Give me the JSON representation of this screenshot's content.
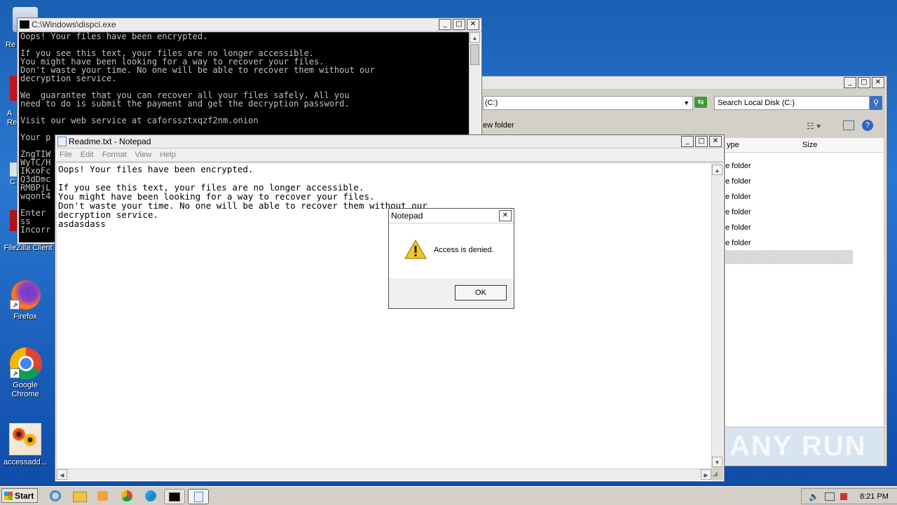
{
  "desktop": {
    "icons": [
      {
        "label": "Re",
        "icon": "recycle-bin-icon"
      },
      {
        "label": "A\nRe",
        "icon": "acrobat-reader-icon"
      },
      {
        "label": "C",
        "icon": "ccleaner-icon"
      },
      {
        "label": "FileZilla Client",
        "icon": "filezilla-icon"
      },
      {
        "label": "Firefox",
        "icon": "firefox-icon"
      },
      {
        "label": "Google\nChrome",
        "icon": "chrome-icon"
      },
      {
        "label": "accessadd...",
        "icon": "flowers-file-icon"
      }
    ]
  },
  "console_window": {
    "title": "C:\\Windows\\dispci.exe",
    "text": "Oops! Your files have been encrypted.\n\nIf you see this text, your files are no longer accessible.\nYou might have been looking for a way to recover your files.\nDon't waste your time. No one will be able to recover them without our\ndecryption service.\n\nWe  guarantee that you can recover all your files safely. All you\nneed to do is submit the payment and get the decryption password.\n\nVisit our web service at caforssztxqzf2nm.onion\n\nYour p\n\nZngTIW\nWyTC/H\nIKxoFc\nQ3dDmc\nRMBPjL\nwqont4\n\nEnter\nss\nIncorr"
  },
  "explorer_window": {
    "address": "(C:)",
    "search_placeholder": "Search Local Disk (C:)",
    "toolbar_new_folder": "ew folder",
    "columns": [
      "ype",
      "Size"
    ],
    "rows": [
      {
        "type": "e folder",
        "size": ""
      },
      {
        "type": "e folder",
        "size": ""
      },
      {
        "type": "e folder",
        "size": ""
      },
      {
        "type": "e folder",
        "size": ""
      },
      {
        "type": "e folder",
        "size": ""
      },
      {
        "type": "e folder",
        "size": ""
      },
      {
        "type": "ext Document",
        "size": "2 KB"
      }
    ],
    "watermark": "ANY RUN"
  },
  "notepad_window": {
    "title": "Readme.txt - Notepad",
    "menu": [
      "File",
      "Edit",
      "Format",
      "View",
      "Help"
    ],
    "text": "Oops! Your files have been encrypted.\n\nIf you see this text, your files are no longer accessible.\nYou might have been looking for a way to recover your files.\nDon't waste your time. No one will be able to recover them without our\ndecryption service.\nasdasdass"
  },
  "dialog": {
    "title": "Notepad",
    "message": "Access is denied.",
    "ok_label": "OK"
  },
  "taskbar": {
    "start_label": "Start",
    "clock": "8:21 PM"
  }
}
